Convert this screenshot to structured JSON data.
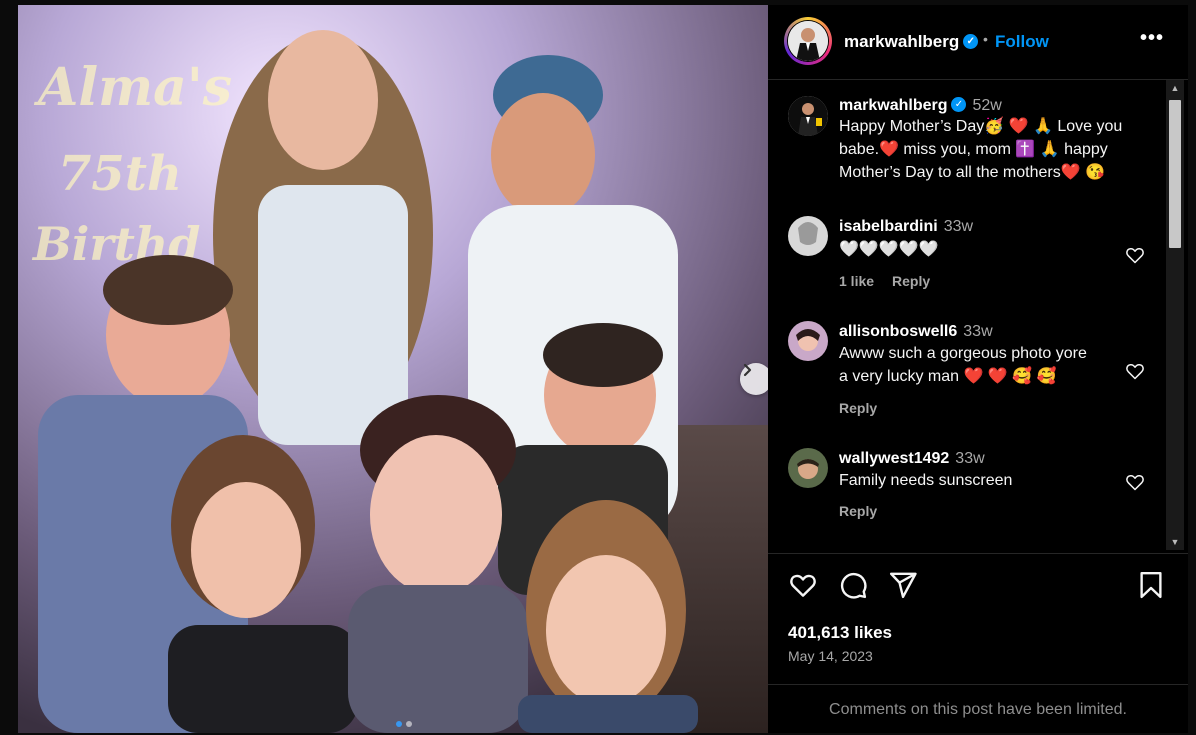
{
  "post": {
    "author": "markwahlberg",
    "follow_label": "Follow",
    "separator": "•",
    "more_label": "•••",
    "caption": {
      "username": "markwahlberg",
      "time": "52w",
      "line1": "Happy Mother’s Day🥳 ❤️ 🙏 Love you",
      "line2": "babe.❤️  miss you, mom ✝️ 🙏  happy",
      "line3": "Mother’s Day to all the mothers❤️  😘"
    },
    "likes": "401,613 likes",
    "date": "May 14, 2023",
    "comments_limited": "Comments on this post have been limited."
  },
  "comments": [
    {
      "username": "isabelbardini",
      "time": "33w",
      "text": "🤍🤍🤍🤍🤍",
      "likes": "1 like",
      "reply": "Reply"
    },
    {
      "username": "allisonboswell6",
      "time": "33w",
      "line1": "Awww such a gorgeous photo yore",
      "line2": "a very lucky man  ❤️  ❤️  🥰  🥰",
      "reply": "Reply"
    },
    {
      "username": "wallywest1492",
      "time": "33w",
      "text": "Family needs sunscreen",
      "reply": "Reply"
    }
  ],
  "icons": {
    "like": "heart-icon",
    "comment": "comment-icon",
    "share": "share-icon",
    "save": "bookmark-icon",
    "next": "chevron-right-icon"
  },
  "colors": {
    "accent": "#0095f6",
    "background": "#000000",
    "muted": "#a8a8a8"
  },
  "carousel": {
    "slides": 2,
    "active": 1
  }
}
